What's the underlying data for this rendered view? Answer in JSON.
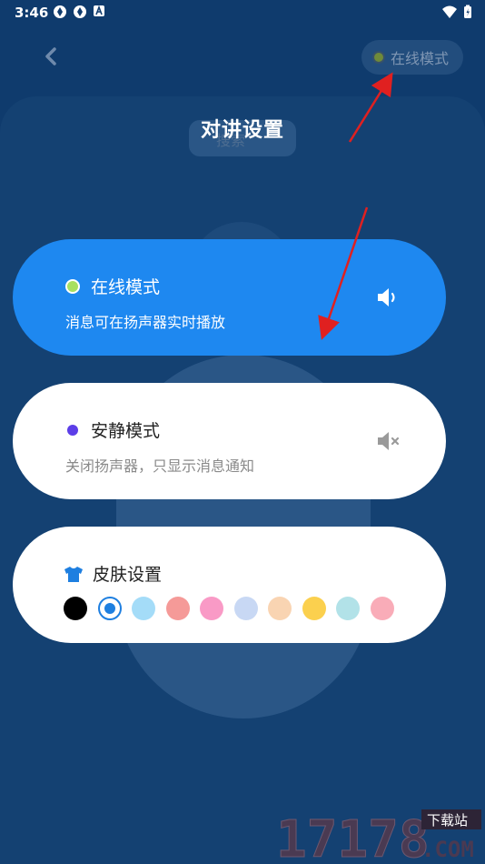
{
  "status_bar": {
    "time": "3:46"
  },
  "header": {
    "mode_pill_label": "在线模式",
    "search_label": "搜索"
  },
  "sheet": {
    "title": "对讲设置",
    "online": {
      "title": "在线模式",
      "subtitle": "消息可在扬声器实时播放"
    },
    "silent": {
      "title": "安静模式",
      "subtitle": "关闭扬声器，只显示消息通知"
    },
    "skin": {
      "title": "皮肤设置",
      "swatches": [
        "#000000",
        "#1e7fe0",
        "#a4dcf8",
        "#f59a98",
        "#f99ac6",
        "#c8d8f4",
        "#f9d4b2",
        "#fbd04e",
        "#b2e2e8",
        "#f9acb8"
      ],
      "selected_index": 1
    }
  },
  "colors": {
    "background": "#0f3b6d",
    "accent": "#1e88f0",
    "annotation_arrow": "#e02020"
  },
  "watermark": {
    "number": "17178",
    "tagline": "下载站",
    "suffix": ".COM"
  }
}
